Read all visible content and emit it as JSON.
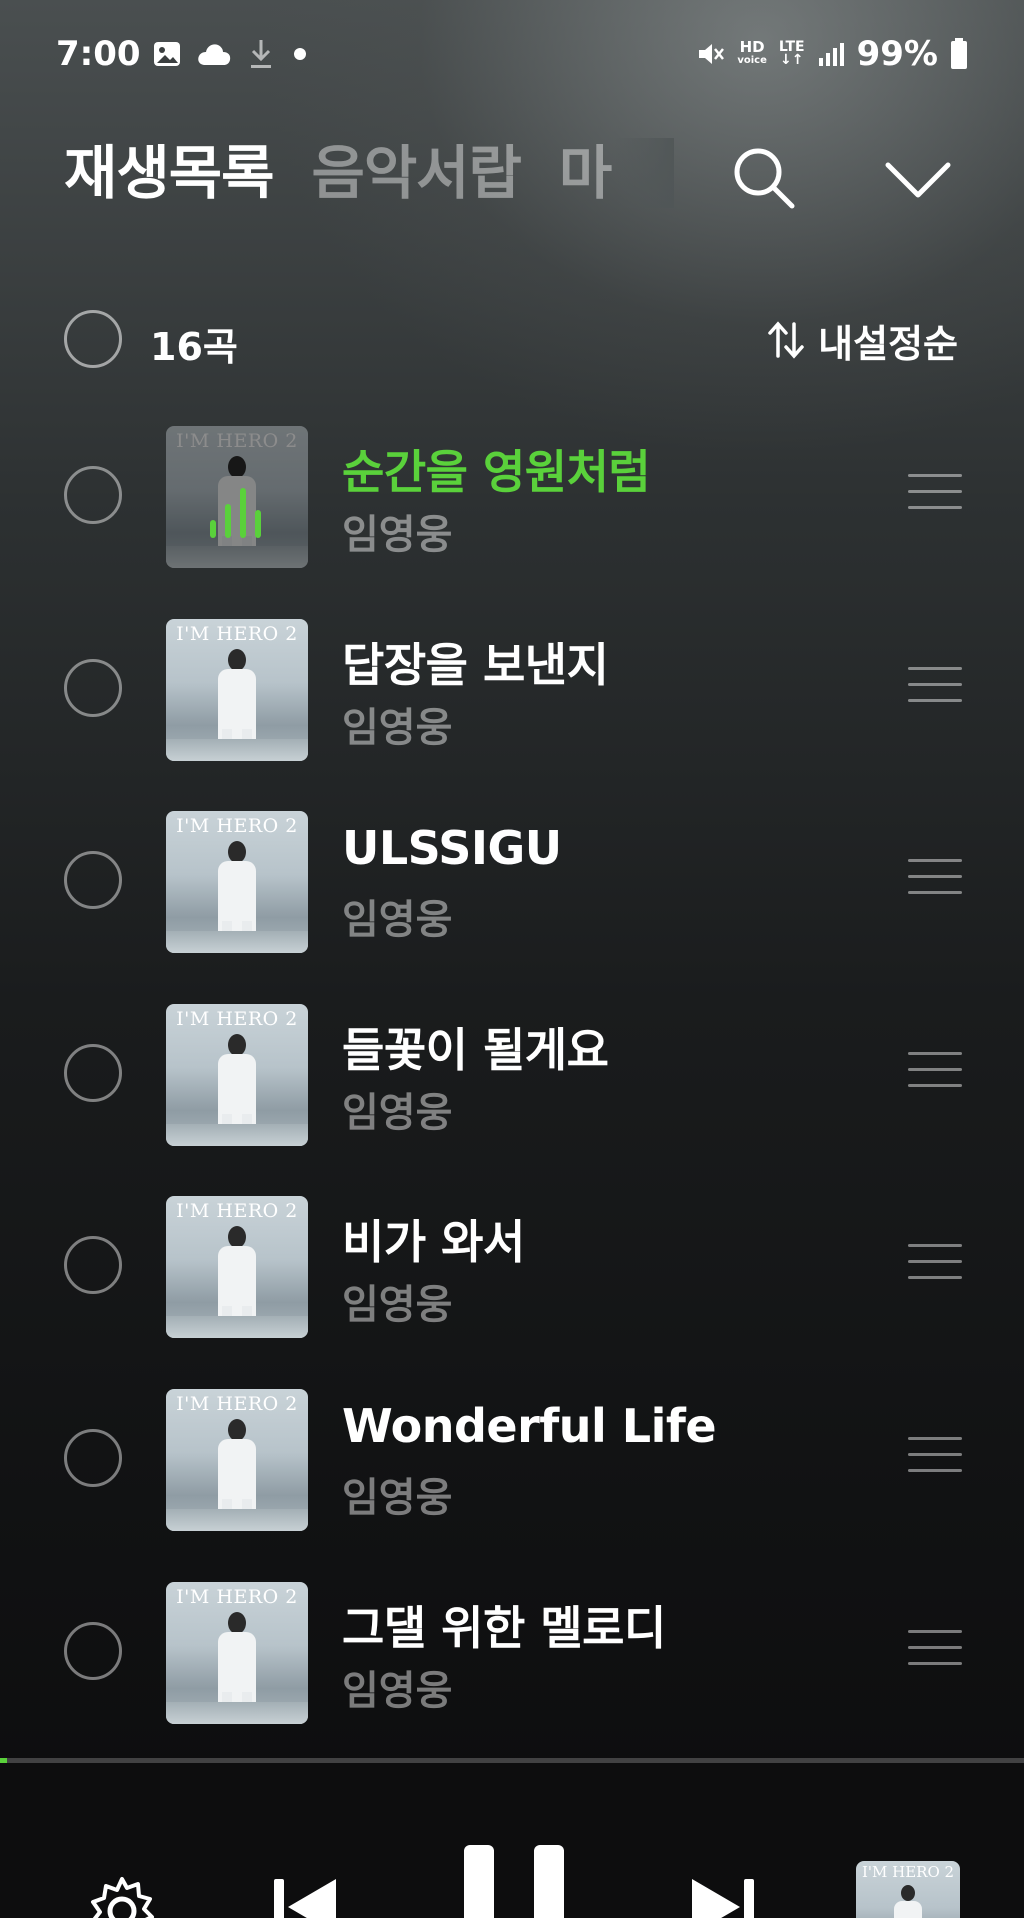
{
  "status_bar": {
    "time": "7:00",
    "hd_label": "HD",
    "voice_label": "voice",
    "lte_label": "LTE",
    "battery": "99%"
  },
  "tabs": [
    {
      "label": "재생목록",
      "active": true
    },
    {
      "label": "음악서랍",
      "active": false
    },
    {
      "label": "마",
      "active": false
    }
  ],
  "list_header": {
    "count": "16곡",
    "sort_icon": "sort-arrows-icon",
    "sort_label": "내설정순"
  },
  "album_art_title": "I'M HERO 2",
  "tracks": [
    {
      "title": "순간을 영원처럼",
      "artist": "임영웅",
      "playing": true
    },
    {
      "title": "답장을 보낸지",
      "artist": "임영웅",
      "playing": false
    },
    {
      "title": "ULSSIGU",
      "artist": "임영웅",
      "playing": false
    },
    {
      "title": "들꽃이 될게요",
      "artist": "임영웅",
      "playing": false
    },
    {
      "title": "비가 와서",
      "artist": "임영웅",
      "playing": false
    },
    {
      "title": "Wonderful Life",
      "artist": "임영웅",
      "playing": false
    },
    {
      "title": "그댈 위한 멜로디",
      "artist": "임영웅",
      "playing": false
    }
  ],
  "player": {
    "progress": 0.007,
    "state": "playing"
  },
  "colors": {
    "accent": "#5ad13b",
    "background": "#0e0f10"
  }
}
